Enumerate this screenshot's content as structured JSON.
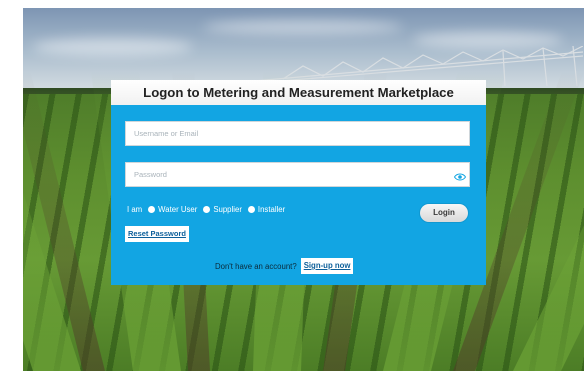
{
  "login": {
    "title": "Logon to Metering and Measurement Marketplace",
    "username_placeholder": "Username or Email",
    "password_placeholder": "Password",
    "role_prefix": "I am",
    "roles": [
      "Water User",
      "Supplier",
      "Installer"
    ],
    "login_label": "Login",
    "reset_label": "Reset Password",
    "signup_prompt": "Don't have an account?",
    "signup_label": "Sign-up now"
  },
  "colors": {
    "panel": "#12a5e3",
    "link": "#0d5f9a"
  },
  "icons": {
    "password_toggle": "eye-icon"
  }
}
